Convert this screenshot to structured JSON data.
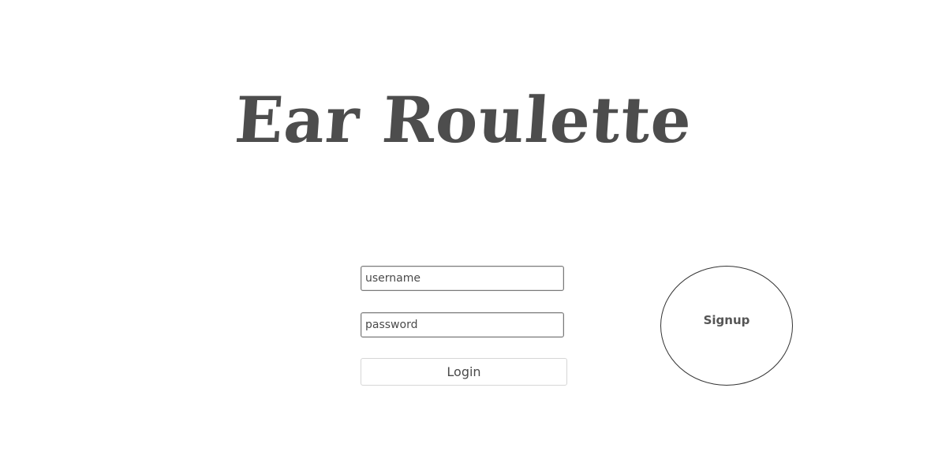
{
  "app": {
    "title": "Ear Roulette"
  },
  "login_form": {
    "username_placeholder": "username",
    "password_placeholder": "password",
    "login_label": "Login"
  },
  "signup": {
    "label": "Signup"
  }
}
